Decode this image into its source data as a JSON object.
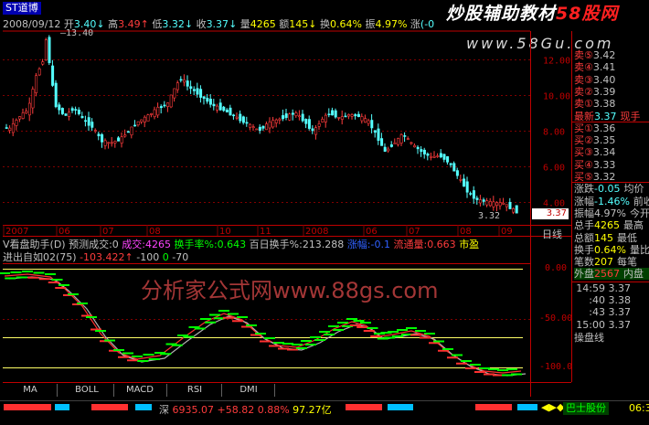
{
  "header": {
    "title": "ST道博",
    "date": "2008/09/12",
    "open_label": "开",
    "open": "3.40",
    "high_label": "高",
    "high": "3.49",
    "low_label": "低",
    "low": "3.32",
    "close_label": "收",
    "close": "3.37",
    "vol_label": "量",
    "vol": "4265",
    "amount_label": "额",
    "amount": "145",
    "turnover_label": "换",
    "turnover": "0.64%",
    "amplitude_label": "振",
    "amplitude": "4.97%",
    "change_label": "涨",
    "change": "(-0"
  },
  "watermarks": {
    "top_cn": "炒股辅助教材",
    "top_en": "58股网",
    "top_url": "www.58Gu.com",
    "mid": "分析家公式网www.88gs.com"
  },
  "main_chart": {
    "max_label": "13.40",
    "min_label": "3.32",
    "price_marker": "3.37",
    "y_ticks": [
      "12.00",
      "10.00",
      "8.00",
      "6.00",
      "4.00"
    ],
    "x_ticks": [
      "2007",
      "06",
      "07",
      "08",
      "10",
      "11",
      "2008",
      "06",
      "07",
      "08",
      "09"
    ],
    "day_line_label": "日线"
  },
  "indicator_bar": {
    "name": "V看盘助手(D)",
    "forecast": "预测成交:0",
    "volume": "成交:4265",
    "turnover_rate": "换手率%:0.643",
    "hundred_day": "百日换手%:213.288",
    "ratio": "涨幅:-0.1",
    "vol_ratio": "流通量:0.663",
    "pe": "市盈"
  },
  "sub_chart": {
    "label": "进出自如02(75)",
    "v1": "-103.422",
    "v2": "-100",
    "v3": "0",
    "v4": "-70",
    "y_ticks": [
      "0.00",
      "-50.00",
      "-100.0"
    ]
  },
  "bottom_tabs": [
    "MA",
    "BOLL",
    "MACD",
    "RSI",
    "DMI"
  ],
  "status_bar": {
    "index_label": "深",
    "index_value": "6935.07",
    "index_change": "+58.82",
    "index_pct": "0.88%",
    "index_amount": "97.27亿",
    "right_icons": "◀▶◆",
    "stock_info": "巴士股份",
    "time": "06:3"
  },
  "order_book": {
    "sells": [
      {
        "label": "卖⑤",
        "price": "3.42"
      },
      {
        "label": "卖④",
        "price": "3.41"
      },
      {
        "label": "卖③",
        "price": "3.40"
      },
      {
        "label": "卖②",
        "price": "3.39"
      },
      {
        "label": "卖①",
        "price": "3.38"
      }
    ],
    "last_label": "最新",
    "last_price": "3.37",
    "last_extra": "现手",
    "buys": [
      {
        "label": "买①",
        "price": "3.36"
      },
      {
        "label": "买②",
        "price": "3.35"
      },
      {
        "label": "买③",
        "price": "3.34"
      },
      {
        "label": "买④",
        "price": "3.33"
      },
      {
        "label": "买⑤",
        "price": "3.32"
      }
    ],
    "stats": [
      {
        "label": "涨跌",
        "value": "-0.05",
        "extra": "均价"
      },
      {
        "label": "涨幅",
        "value": "-1.46%",
        "extra": "前收"
      },
      {
        "label": "振幅",
        "value": "4.97%",
        "extra": "今开"
      },
      {
        "label": "总手",
        "value": "4265",
        "extra": "最高"
      },
      {
        "label": "总额",
        "value": "145",
        "extra": "最低"
      },
      {
        "label": "换手",
        "value": "0.64%",
        "extra": "量比"
      },
      {
        "label": "笔数",
        "value": "207",
        "extra": "每笔"
      },
      {
        "label": "外盘",
        "value": "2567",
        "extra": "内盘"
      }
    ],
    "ticks": [
      {
        "time": "14:59",
        "price": "3.37"
      },
      {
        "time": ":40",
        "price": "3.38"
      },
      {
        "time": ":43",
        "price": "3.37"
      },
      {
        "time": "15:00",
        "price": "3.37"
      }
    ],
    "bottom_label": "操盘线"
  },
  "colors": {
    "up": "#ff3c3c",
    "down": "#54ffff",
    "axis": "#c00000",
    "yellow": "#ffff00",
    "green": "#00ff00",
    "magenta": "#ff44ff"
  }
}
